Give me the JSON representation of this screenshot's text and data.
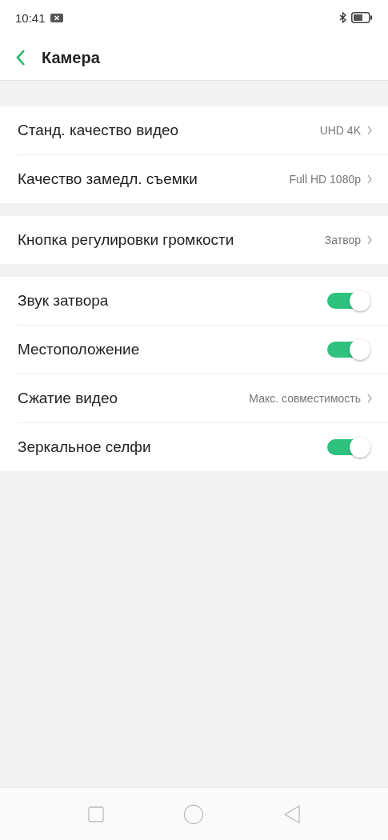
{
  "status_bar": {
    "time": "10:41"
  },
  "header": {
    "title": "Камера"
  },
  "groups": [
    {
      "items": [
        {
          "kind": "link",
          "label": "Станд. качество видео",
          "value": "UHD 4K"
        },
        {
          "kind": "link",
          "label": "Качество замедл. съемки",
          "value": "Full HD 1080p"
        }
      ]
    },
    {
      "items": [
        {
          "kind": "link",
          "label": "Кнопка регулировки громкости",
          "value": "Затвор"
        }
      ]
    },
    {
      "items": [
        {
          "kind": "toggle",
          "label": "Звук затвора",
          "on": true
        },
        {
          "kind": "toggle",
          "label": "Местоположение",
          "on": true
        },
        {
          "kind": "link",
          "label": "Сжатие видео",
          "value": "Макс. совместимость"
        },
        {
          "kind": "toggle",
          "label": "Зеркальное селфи",
          "on": true
        }
      ]
    }
  ]
}
